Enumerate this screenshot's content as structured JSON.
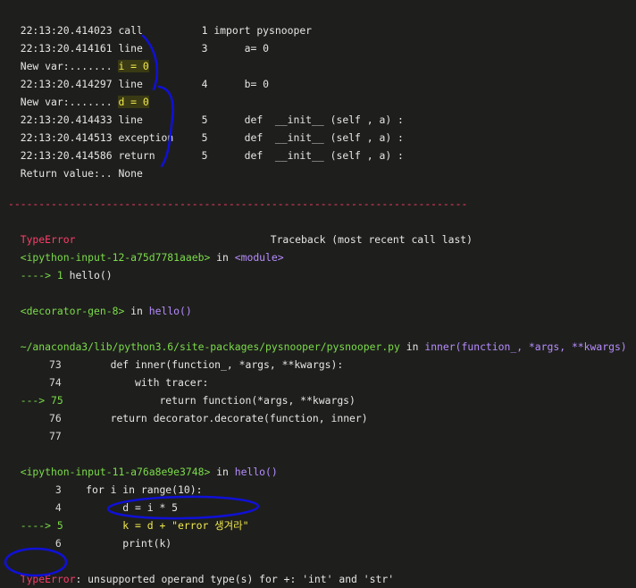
{
  "trace": [
    {
      "time": "22:13:20.414023",
      "event": "call",
      "lineno": "1",
      "code": "import pysnooper"
    },
    {
      "time": "22:13:20.414161",
      "event": "line",
      "lineno": "3",
      "code": "a= 0"
    },
    {
      "newvar_label": "New var:.......",
      "newvar_value": "i = 0"
    },
    {
      "time": "22:13:20.414297",
      "event": "line",
      "lineno": "4",
      "code": "b= 0"
    },
    {
      "newvar_label": "New var:.......",
      "newvar_value": "d = 0"
    },
    {
      "time": "22:13:20.414433",
      "event": "line",
      "lineno": "5",
      "code": "def  __init__ (self , a) :"
    },
    {
      "time": "22:13:20.414513",
      "event": "exception",
      "lineno": "5",
      "code": "def  __init__ (self , a) :"
    },
    {
      "time": "22:13:20.414586",
      "event": "return",
      "lineno": "5",
      "code": "def  __init__ (self , a) :"
    },
    {
      "return_label": "Return value:.. None"
    }
  ],
  "divider": "---------------------------------------------------------------------------",
  "error_header": {
    "name": "TypeError",
    "traceback": "Traceback (most recent call last)"
  },
  "frames": [
    {
      "file": "<ipython-input-12-a75d7781aaeb>",
      "in": "in",
      "func": "<module>",
      "lines": [
        {
          "marker": "----> 1",
          "code": "hello()"
        }
      ]
    },
    {
      "file": "<decorator-gen-8>",
      "in": "in",
      "func": "hello()"
    },
    {
      "file": "~/anaconda3/lib/python3.6/site-packages/pysnooper/pysnooper.py",
      "in": "in",
      "func": "inner",
      "args": "(function_, *args, **kwargs)",
      "lines": [
        {
          "num": "73",
          "code": "def inner(function_, *args, **kwargs):"
        },
        {
          "num": "74",
          "code": "with tracer:"
        },
        {
          "marker": "---> 75",
          "code": "return function(*args, **kwargs)"
        },
        {
          "num": "76",
          "code": "return decorator.decorate(function, inner)"
        },
        {
          "num": "77",
          "code": ""
        }
      ]
    },
    {
      "file": "<ipython-input-11-a76a8e9e3748>",
      "in": "in",
      "func": "hello()",
      "lines": [
        {
          "num": "3",
          "code": "for i in range(10):"
        },
        {
          "num": "4",
          "code": "d = i * 5"
        },
        {
          "marker": "----> 5",
          "code": "k = d + \"error 생겨라\""
        },
        {
          "num": "6",
          "code": "print(k)"
        }
      ]
    }
  ],
  "final_error": {
    "name": "TypeError",
    "message": ": unsupported operand type(s) for +: 'int' and 'str'"
  },
  "colors": {
    "background": "#1e1f1c",
    "error_red": "#ff3b6b",
    "file_green": "#7cdb4b",
    "func_purple": "#b78cff",
    "annotation_blue": "#1010d8"
  }
}
